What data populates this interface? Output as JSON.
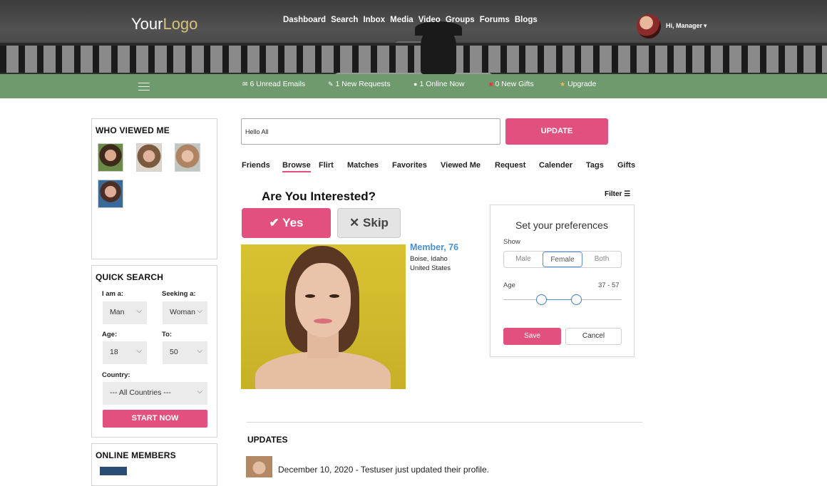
{
  "header": {
    "logo": {
      "part1": "Your",
      "part2": "Logo"
    },
    "nav": [
      "Dashboard",
      "Search",
      "Inbox",
      "Media",
      "Video",
      "Groups",
      "Forums",
      "Blogs"
    ],
    "greeting": "Hi, Manager"
  },
  "statusbar": {
    "emails": "6 Unread Emails",
    "requests": "1 New Requests",
    "online": "1 Online Now",
    "gifts": "0 New Gifts",
    "upgrade": "Upgrade"
  },
  "who_viewed": {
    "title": "WHO VIEWED ME"
  },
  "quick_search": {
    "title": "QUICK SEARCH",
    "i_am_label": "I am a:",
    "i_am_value": "Man",
    "seeking_label": "Seeking a:",
    "seeking_value": "Woman",
    "age_label": "Age:",
    "age_value": "18",
    "to_label": "To:",
    "to_value": "50",
    "country_label": "Country:",
    "country_value": "--- All Countries ---",
    "start_button": "START NOW"
  },
  "online_members": {
    "title": "ONLINE MEMBERS"
  },
  "status_update": {
    "input_value": "Hello All",
    "button": "UPDATE"
  },
  "tabs": [
    "Friends",
    "Browse",
    "Flirt",
    "Matches",
    "Favorites",
    "Viewed Me",
    "Request",
    "Calender",
    "Tags",
    "Gifts"
  ],
  "active_tab": "Browse",
  "encounter": {
    "question": "Are You Interested?",
    "yes": "Yes",
    "skip": "Skip",
    "filter": "Filter",
    "member_name": "Member, 76",
    "city": "Boise, Idaho",
    "country": "United States"
  },
  "preferences": {
    "title": "Set your preferences",
    "show_label": "Show",
    "options": [
      "Male",
      "Female",
      "Both"
    ],
    "selected": "Female",
    "age_label": "Age",
    "age_range": "37 - 57",
    "age_min": 37,
    "age_max": 57,
    "save": "Save",
    "cancel": "Cancel"
  },
  "updates": {
    "title": "UPDATES",
    "items": [
      {
        "text": "December 10, 2020 - Testuser  just updated their profile."
      }
    ]
  },
  "colors": {
    "accent": "#e2507f",
    "green": "#6f9a6d",
    "link_blue": "#4a8fd6"
  }
}
